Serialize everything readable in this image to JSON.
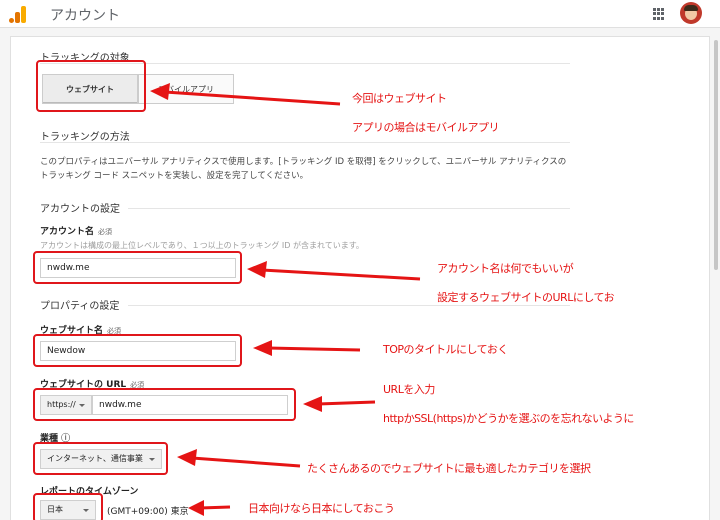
{
  "header": {
    "title": "アカウント"
  },
  "tracking_target": {
    "section_title": "トラッキングの対象",
    "tabs": [
      {
        "label": "ウェブサイト",
        "selected": true
      },
      {
        "label": "モバイルアプリ",
        "selected": false
      }
    ]
  },
  "tracking_method": {
    "section_title": "トラッキングの方法",
    "description": "このプロパティはユニバーサル アナリティクスで使用します。[トラッキング ID を取得] をクリックして、ユニバーサル アナリティクスのトラッキング コード スニペットを実装し、設定を完了してください。"
  },
  "account_settings": {
    "section_title": "アカウントの設定",
    "account_name_label": "アカウント名",
    "required": "必須",
    "account_name_hint": "アカウントは構成の最上位レベルであり、１つ以上のトラッキング ID が含まれています。",
    "account_name_value": "nwdw.me"
  },
  "property_settings": {
    "section_title": "プロパティの設定",
    "website_name_label": "ウェブサイト名",
    "required": "必須",
    "website_name_value": "Newdow",
    "website_url_label": "ウェブサイトの URL",
    "protocol_value": "https://",
    "url_value": "nwdw.me",
    "industry_label": "業種",
    "industry_value": "インターネット、通信事業",
    "timezone_label": "レポートのタイムゾーン",
    "country_value": "日本",
    "timezone_value": "(GMT+09:00) 東京"
  },
  "annotations": {
    "website_1": "今回はウェブサイト",
    "website_2": "アプリの場合はモバイルアプリ",
    "account_1": "アカウント名は何でもいいが",
    "account_2": "設定するウェブサイトのURLにしてお",
    "website_name": "TOPのタイトルにしておく",
    "url_1": "URLを入力",
    "url_2": "httpかSSL(https)かどうかを選ぶのを忘れないように",
    "industry": "たくさんあるのでウェブサイトに最も適したカテゴリを選択",
    "timezone": "日本向けなら日本にしておこう"
  },
  "colors": {
    "annotation_red": "#e51414",
    "logo_orange": "#f9ab00"
  },
  "icons": [
    "analytics-logo-icon",
    "apps-grid-icon",
    "user-avatar-icon",
    "help-icon",
    "chevron-down-icon",
    "red-arrow-icon"
  ]
}
